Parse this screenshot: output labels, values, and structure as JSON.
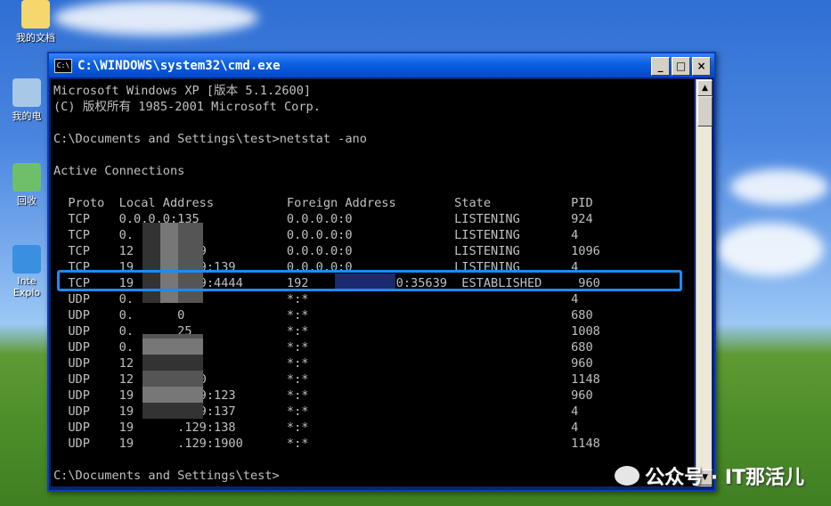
{
  "desktop": {
    "icons": [
      {
        "label": "我的文档",
        "icon": "my-documents-icon"
      },
      {
        "label": "我的电",
        "icon": "my-computer-icon"
      },
      {
        "label": "回收",
        "icon": "recycle-bin-icon"
      },
      {
        "label": "Inte Explo",
        "icon": "internet-explorer-icon"
      }
    ]
  },
  "window": {
    "title": "C:\\WINDOWS\\system32\\cmd.exe",
    "icon": "cmd-icon",
    "icon_text": "C:\\",
    "controls": {
      "minimize": "_",
      "maximize": "□",
      "close": "×"
    }
  },
  "console": {
    "lines": [
      "Microsoft Windows XP [版本 5.1.2600]",
      "(C) 版权所有 1985-2001 Microsoft Corp.",
      "",
      "C:\\Documents and Settings\\test>netstat -ano",
      "",
      "Active Connections",
      "",
      "  Proto  Local Address          Foreign Address        State           PID",
      "  TCP    0.0.0.0:135            0.0.0.0:0              LISTENING       924",
      "  TCP    0.      5              0.0.0.0:0              LISTENING       4",
      "  TCP    12      1029           0.0.0.0:0              LISTENING       1096",
      "  TCP    19      .129:139       0.0.0.0:0              LISTENING       4",
      "  TCP    19      .129:4444      192          130:35639  ESTABLISHED     960",
      "  UDP    0.      5              *:*                                    4",
      "  UDP    0.      0              *:*                                    680",
      "  UDP    0.      25             *:*                                    1008",
      "  UDP    0.      00             *:*                                    680",
      "  UDP    12      123            *:*                                    960",
      "  UDP    12      1900           *:*                                    1148",
      "  UDP    19      .129:123       *:*                                    960",
      "  UDP    19      .129:137       *:*                                    4",
      "  UDP    19      .129:138       *:*                                    4",
      "  UDP    19      .129:1900      *:*                                    1148",
      "",
      "C:\\Documents and Settings\\test>"
    ]
  },
  "watermark": {
    "text": "公众号 · IT那活儿"
  },
  "colors": {
    "console_bg": "#000000",
    "console_fg": "#c0c0c0",
    "highlight": "#1d8bf1",
    "titlebar": "#0548c8"
  }
}
